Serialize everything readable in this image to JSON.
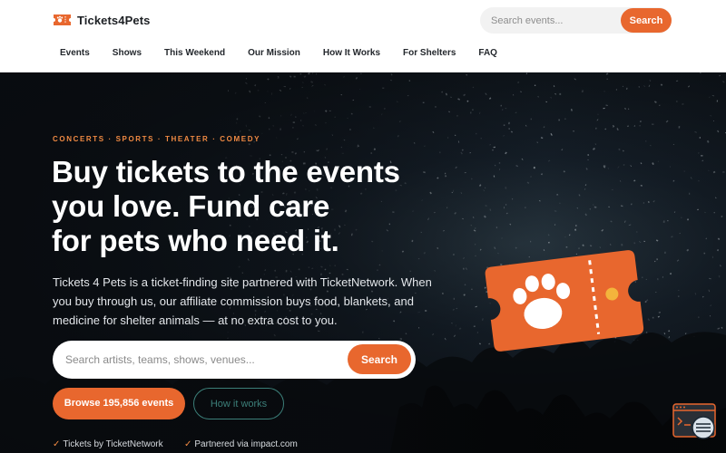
{
  "header": {
    "brand": "Tickets4Pets",
    "search_placeholder": "Search events...",
    "search_button": "Search",
    "nav": [
      "Events",
      "Shows",
      "This Weekend",
      "Our Mission",
      "How It Works",
      "For Shelters",
      "FAQ"
    ]
  },
  "hero": {
    "kicker": "CONCERTS · SPORTS · THEATER · COMEDY",
    "headline_line1": "Buy tickets to the events",
    "headline_line2": "you love. Fund care",
    "headline_line3": "for pets who need it.",
    "subtext": "Tickets 4 Pets is a ticket-finding site partnered with TicketNetwork. When you buy through us, our affiliate commission buys food, blankets, and medicine for shelter animals — at no extra cost to you.",
    "search_placeholder": "Search artists, teams, shows, venues...",
    "search_button": "Search",
    "browse_button": "Browse 195,856 events",
    "how_button": "How it works",
    "trust": [
      "Tickets by TicketNetwork",
      "Partnered via impact.com"
    ],
    "check_glyph": "✓"
  },
  "colors": {
    "accent": "#e8672e",
    "accent_text": "#f08a43",
    "teal": "#3c7f79",
    "header_bg": "#ffffff",
    "hero_bg": "#0d1116"
  },
  "icons": [
    "ticket-logo-icon",
    "paw-ticket-icon",
    "accessibility-widget-icon"
  ]
}
